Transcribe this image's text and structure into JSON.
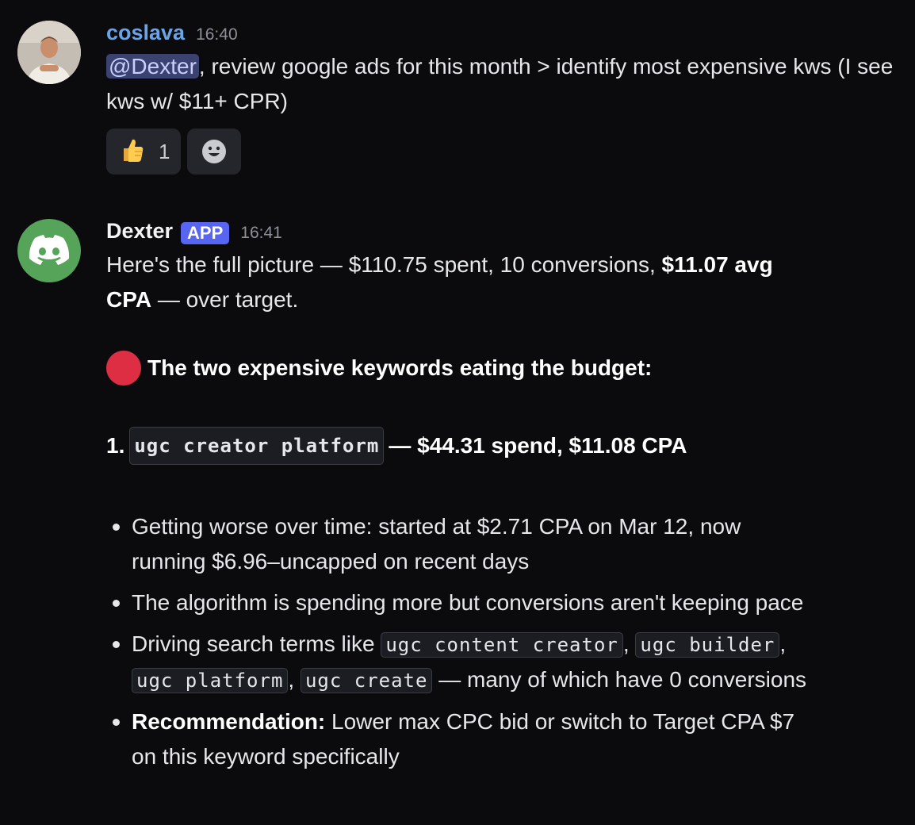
{
  "messages": [
    {
      "author": "coslava",
      "time": "16:40",
      "mention": "@Dexter",
      "text": ", review google ads for this month > identify most expensive kws (I see kws w/ $11+ CPR)",
      "reactions": [
        {
          "emoji": "👍",
          "count": "1"
        }
      ]
    },
    {
      "author": "Dexter",
      "badge": "APP",
      "time": "16:41",
      "intro_part1": "Here's the full picture — $110.75 spent, 10 conversions, ",
      "intro_bold": "$11.07 avg CPA",
      "intro_part2": " — over target.",
      "section_heading": "The two expensive keywords eating the budget:",
      "item1": {
        "number": "1.",
        "keyword": "ugc creator platform",
        "summary": " — $44.31 spend, $11.08 CPA"
      },
      "bullets": {
        "b1": "Getting worse over time: started at $2.71 CPA on Mar 12, now running $6.96–uncapped on recent days",
        "b2": "The algorithm is spending more but conversions aren't keeping pace",
        "b3_prefix": "Driving search terms like ",
        "b3_terms": [
          "ugc content creator",
          "ugc builder",
          "ugc platform",
          "ugc create"
        ],
        "b3_suffix": " — many of which have 0 conversions",
        "b4_bold": "Recommendation:",
        "b4_text": " Lower max CPC bid or switch to Target CPA $7 on this keyword specifically"
      }
    }
  ],
  "colors": {
    "background": "#0b0b0d",
    "coslava_name": "#6aa4e8",
    "app_badge": "#5865f2",
    "bot_avatar": "#56a35a",
    "mention_bg": "#3c4270"
  }
}
